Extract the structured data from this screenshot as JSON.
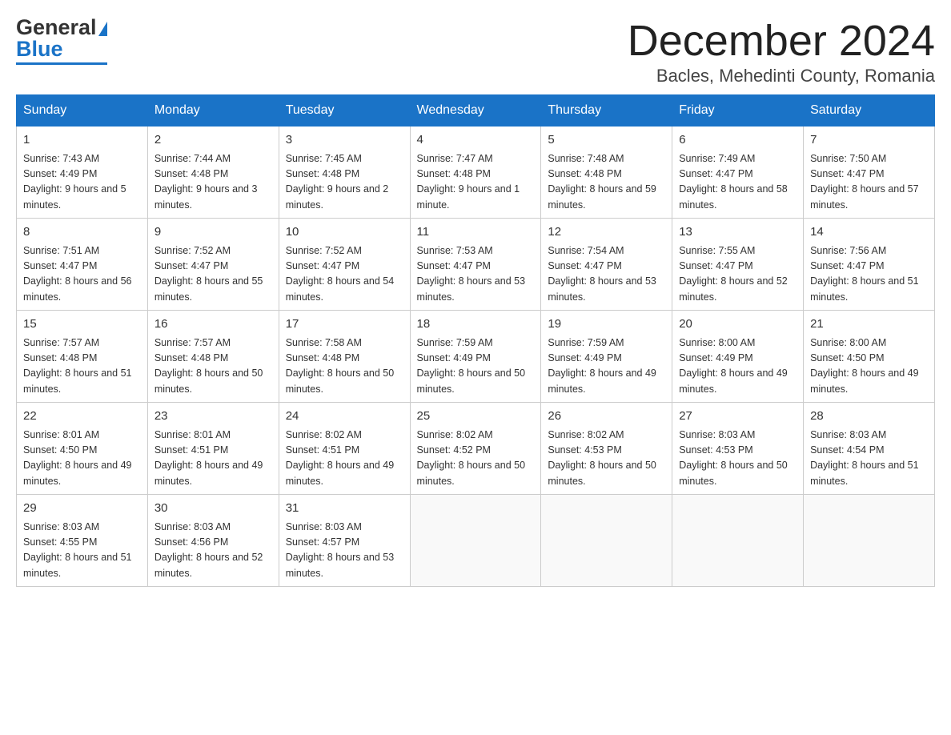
{
  "header": {
    "logo_general": "General",
    "logo_blue": "Blue",
    "title": "December 2024",
    "location": "Bacles, Mehedinti County, Romania"
  },
  "weekdays": [
    "Sunday",
    "Monday",
    "Tuesday",
    "Wednesday",
    "Thursday",
    "Friday",
    "Saturday"
  ],
  "weeks": [
    [
      {
        "day": "1",
        "sunrise": "7:43 AM",
        "sunset": "4:49 PM",
        "daylight": "9 hours and 5 minutes."
      },
      {
        "day": "2",
        "sunrise": "7:44 AM",
        "sunset": "4:48 PM",
        "daylight": "9 hours and 3 minutes."
      },
      {
        "day": "3",
        "sunrise": "7:45 AM",
        "sunset": "4:48 PM",
        "daylight": "9 hours and 2 minutes."
      },
      {
        "day": "4",
        "sunrise": "7:47 AM",
        "sunset": "4:48 PM",
        "daylight": "9 hours and 1 minute."
      },
      {
        "day": "5",
        "sunrise": "7:48 AM",
        "sunset": "4:48 PM",
        "daylight": "8 hours and 59 minutes."
      },
      {
        "day": "6",
        "sunrise": "7:49 AM",
        "sunset": "4:47 PM",
        "daylight": "8 hours and 58 minutes."
      },
      {
        "day": "7",
        "sunrise": "7:50 AM",
        "sunset": "4:47 PM",
        "daylight": "8 hours and 57 minutes."
      }
    ],
    [
      {
        "day": "8",
        "sunrise": "7:51 AM",
        "sunset": "4:47 PM",
        "daylight": "8 hours and 56 minutes."
      },
      {
        "day": "9",
        "sunrise": "7:52 AM",
        "sunset": "4:47 PM",
        "daylight": "8 hours and 55 minutes."
      },
      {
        "day": "10",
        "sunrise": "7:52 AM",
        "sunset": "4:47 PM",
        "daylight": "8 hours and 54 minutes."
      },
      {
        "day": "11",
        "sunrise": "7:53 AM",
        "sunset": "4:47 PM",
        "daylight": "8 hours and 53 minutes."
      },
      {
        "day": "12",
        "sunrise": "7:54 AM",
        "sunset": "4:47 PM",
        "daylight": "8 hours and 53 minutes."
      },
      {
        "day": "13",
        "sunrise": "7:55 AM",
        "sunset": "4:47 PM",
        "daylight": "8 hours and 52 minutes."
      },
      {
        "day": "14",
        "sunrise": "7:56 AM",
        "sunset": "4:47 PM",
        "daylight": "8 hours and 51 minutes."
      }
    ],
    [
      {
        "day": "15",
        "sunrise": "7:57 AM",
        "sunset": "4:48 PM",
        "daylight": "8 hours and 51 minutes."
      },
      {
        "day": "16",
        "sunrise": "7:57 AM",
        "sunset": "4:48 PM",
        "daylight": "8 hours and 50 minutes."
      },
      {
        "day": "17",
        "sunrise": "7:58 AM",
        "sunset": "4:48 PM",
        "daylight": "8 hours and 50 minutes."
      },
      {
        "day": "18",
        "sunrise": "7:59 AM",
        "sunset": "4:49 PM",
        "daylight": "8 hours and 50 minutes."
      },
      {
        "day": "19",
        "sunrise": "7:59 AM",
        "sunset": "4:49 PM",
        "daylight": "8 hours and 49 minutes."
      },
      {
        "day": "20",
        "sunrise": "8:00 AM",
        "sunset": "4:49 PM",
        "daylight": "8 hours and 49 minutes."
      },
      {
        "day": "21",
        "sunrise": "8:00 AM",
        "sunset": "4:50 PM",
        "daylight": "8 hours and 49 minutes."
      }
    ],
    [
      {
        "day": "22",
        "sunrise": "8:01 AM",
        "sunset": "4:50 PM",
        "daylight": "8 hours and 49 minutes."
      },
      {
        "day": "23",
        "sunrise": "8:01 AM",
        "sunset": "4:51 PM",
        "daylight": "8 hours and 49 minutes."
      },
      {
        "day": "24",
        "sunrise": "8:02 AM",
        "sunset": "4:51 PM",
        "daylight": "8 hours and 49 minutes."
      },
      {
        "day": "25",
        "sunrise": "8:02 AM",
        "sunset": "4:52 PM",
        "daylight": "8 hours and 50 minutes."
      },
      {
        "day": "26",
        "sunrise": "8:02 AM",
        "sunset": "4:53 PM",
        "daylight": "8 hours and 50 minutes."
      },
      {
        "day": "27",
        "sunrise": "8:03 AM",
        "sunset": "4:53 PM",
        "daylight": "8 hours and 50 minutes."
      },
      {
        "day": "28",
        "sunrise": "8:03 AM",
        "sunset": "4:54 PM",
        "daylight": "8 hours and 51 minutes."
      }
    ],
    [
      {
        "day": "29",
        "sunrise": "8:03 AM",
        "sunset": "4:55 PM",
        "daylight": "8 hours and 51 minutes."
      },
      {
        "day": "30",
        "sunrise": "8:03 AM",
        "sunset": "4:56 PM",
        "daylight": "8 hours and 52 minutes."
      },
      {
        "day": "31",
        "sunrise": "8:03 AM",
        "sunset": "4:57 PM",
        "daylight": "8 hours and 53 minutes."
      },
      null,
      null,
      null,
      null
    ]
  ],
  "colors": {
    "header_bg": "#1a73c7",
    "border": "#1a73c7"
  }
}
